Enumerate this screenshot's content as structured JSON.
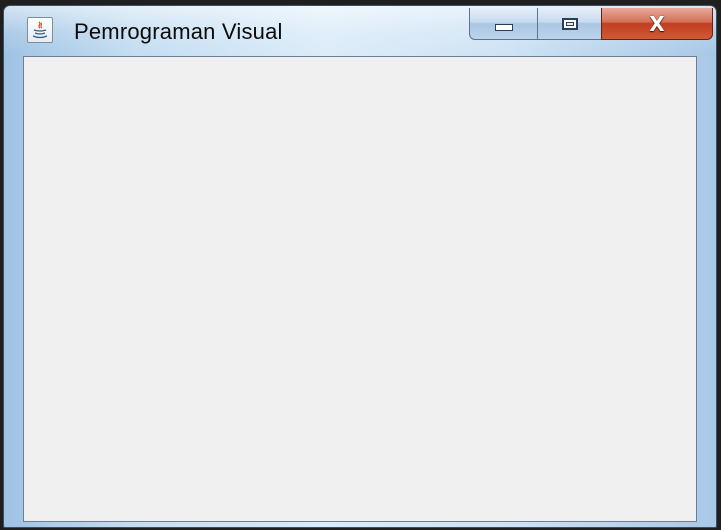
{
  "window": {
    "title": "Pemrograman Visual",
    "icon": "java-coffee-icon",
    "controls": {
      "minimize_icon": "minimize-icon",
      "maximize_icon": "maximize-icon",
      "close_icon": "close-icon",
      "close_glyph": "X"
    }
  },
  "client_area": {
    "background": "#f0f0f0"
  },
  "colors": {
    "close_button": "#c13e22",
    "frame": "#c4ddf2"
  }
}
